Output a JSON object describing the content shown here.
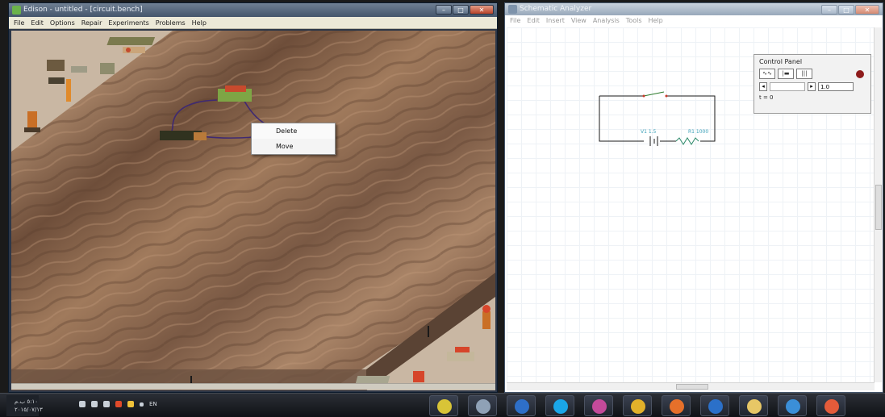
{
  "left_window": {
    "title": "Edison - untitled - [circuit.bench]",
    "menu": [
      "File",
      "Edit",
      "Options",
      "Repair",
      "Experiments",
      "Problems",
      "Help"
    ],
    "buttons": [
      "–",
      "□",
      "✕"
    ]
  },
  "context_menu": {
    "items": [
      "Delete",
      "Move"
    ]
  },
  "right_window": {
    "title": "Schematic Analyzer",
    "menu": [
      "File",
      "Edit",
      "Insert",
      "View",
      "Analysis",
      "Tools",
      "Help"
    ],
    "buttons": [
      "–",
      "□",
      "✕"
    ],
    "schematic": {
      "source_label": "V1 1.5",
      "resistor_label": "R1 1000"
    },
    "control_panel": {
      "title": "Control Panel",
      "tool_buttons": [
        "∿∿",
        "|▬",
        "|||"
      ],
      "value": "1.0",
      "time": "t = 0"
    }
  },
  "taskbar": {
    "clock_time": "٥:١٠ ب.م",
    "clock_date": "٢٠١٥/٠٧/١٣",
    "lang": "EN",
    "apps": [
      {
        "name": "edison",
        "color": "#d8c437"
      },
      {
        "name": "schematic",
        "color": "#8fa1b6"
      },
      {
        "name": "word",
        "color": "#2e6fc8"
      },
      {
        "name": "skype",
        "color": "#1aa6e8"
      },
      {
        "name": "paint",
        "color": "#c44a9a"
      },
      {
        "name": "chrome",
        "color": "#e2b12a"
      },
      {
        "name": "firefox",
        "color": "#e6702a"
      },
      {
        "name": "media-player",
        "color": "#2b70c9"
      },
      {
        "name": "explorer",
        "color": "#e7c766"
      },
      {
        "name": "internet-explorer",
        "color": "#3b8fd8"
      },
      {
        "name": "globe",
        "color": "#e45b3a"
      }
    ]
  }
}
